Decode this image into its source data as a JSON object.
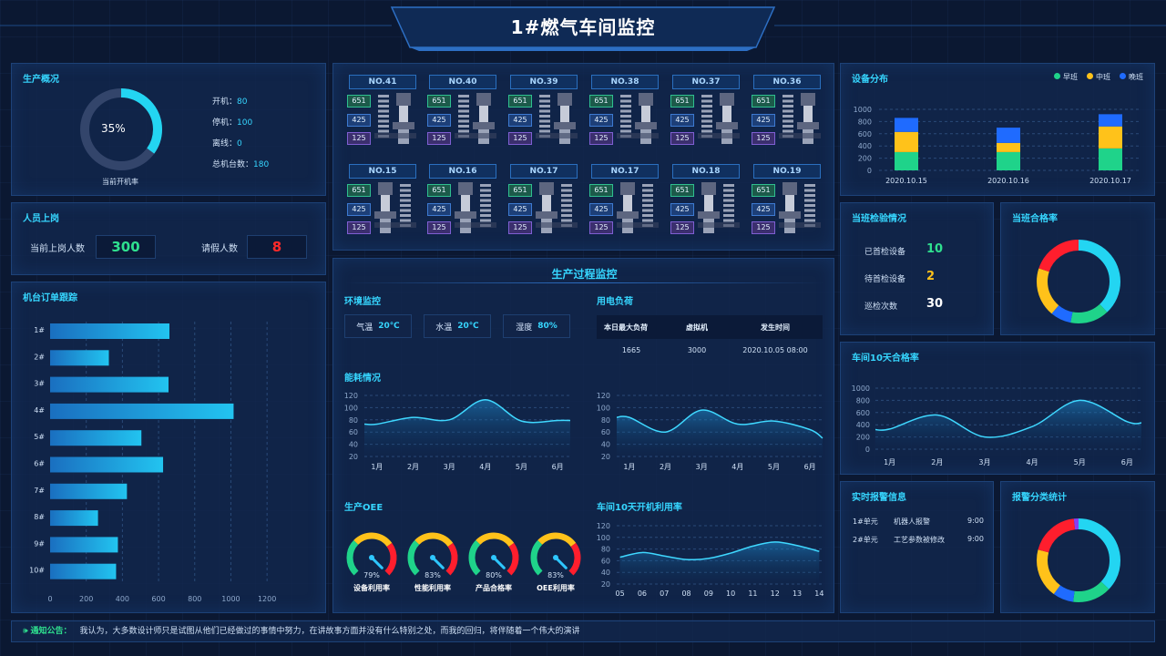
{
  "header": {
    "title": "1#燃气车间监控"
  },
  "production": {
    "title": "生产概况",
    "ring_value": "35%",
    "ring_fraction": 0.35,
    "ring_caption": "当前开机率",
    "stats": [
      {
        "label": "开机：",
        "value": "80"
      },
      {
        "label": "停机：",
        "value": "100"
      },
      {
        "label": "离线：",
        "value": "0"
      },
      {
        "label": "总机台数：",
        "value": "180"
      }
    ]
  },
  "staff": {
    "title": "人员上岗",
    "on_duty_label": "当前上岗人数",
    "on_duty_value": "300",
    "leave_label": "请假人数",
    "leave_value": "8"
  },
  "orders": {
    "title": "机台订单跟踪",
    "chart_data": {
      "type": "bar",
      "orientation": "horizontal",
      "categories": [
        "1#",
        "2#",
        "3#",
        "4#",
        "5#",
        "6#",
        "7#",
        "8#",
        "9#",
        "10#"
      ],
      "values": [
        660,
        325,
        655,
        1015,
        505,
        625,
        425,
        265,
        375,
        365
      ],
      "xlim": [
        0,
        1300
      ],
      "xticks": [
        "0",
        "200",
        "400",
        "600",
        "800",
        "1000",
        "1200"
      ],
      "xtick_values": [
        0,
        200,
        400,
        600,
        800,
        1000,
        1200
      ],
      "grid": true
    }
  },
  "machines": {
    "row1": [
      "NO.41",
      "NO.40",
      "NO.39",
      "NO.38",
      "NO.37",
      "NO.36"
    ],
    "row2": [
      "NO.15",
      "NO.16",
      "NO.17",
      "NO.17",
      "NO.18",
      "NO.19"
    ],
    "values": [
      "651",
      "425",
      "125"
    ]
  },
  "process": {
    "title": "生产过程监控",
    "env": {
      "title": "环境监控",
      "items": [
        {
          "label": "气温",
          "value": "20℃"
        },
        {
          "label": "水温",
          "value": "20℃"
        },
        {
          "label": "湿度",
          "value": "80%"
        }
      ]
    },
    "power": {
      "title": "用电负荷",
      "headers": [
        "本日最大负荷",
        "虚拟机",
        "发生时间"
      ],
      "row": [
        "1665",
        "3000",
        "2020.10.05  08:00"
      ]
    },
    "energy": {
      "title": "能耗情况",
      "chart_data": [
        {
          "type": "area",
          "categories": [
            "1月",
            "2月",
            "3月",
            "4月",
            "5月",
            "6月"
          ],
          "values": [
            73,
            84,
            80,
            113,
            78,
            79
          ],
          "ylim": [
            20,
            120
          ],
          "yticks": [
            "120",
            "100",
            "80",
            "60",
            "40",
            "20"
          ],
          "ytick_values": [
            120,
            100,
            80,
            60,
            40,
            20
          ]
        },
        {
          "type": "area",
          "categories": [
            "1月",
            "2月",
            "3月",
            "4月",
            "5月",
            "6月"
          ],
          "values": [
            84,
            60,
            96,
            73,
            78,
            64
          ],
          "ylim": [
            20,
            120
          ],
          "yticks": [
            "120",
            "100",
            "80",
            "60",
            "40",
            "20"
          ],
          "ytick_values": [
            120,
            100,
            80,
            60,
            40,
            20
          ]
        }
      ]
    },
    "oee": {
      "title": "生产OEE",
      "gauges": [
        {
          "value": "79%",
          "fraction": 0.79,
          "label": "设备利用率"
        },
        {
          "value": "83%",
          "fraction": 0.83,
          "label": "性能利用率"
        },
        {
          "value": "80%",
          "fraction": 0.8,
          "label": "产品合格率"
        },
        {
          "value": "83%",
          "fraction": 0.83,
          "label": "OEE利用率"
        }
      ]
    },
    "utilization": {
      "title": "车间10天开机利用率",
      "chart_data": {
        "type": "area",
        "categories": [
          "05",
          "06",
          "07",
          "08",
          "09",
          "10",
          "11",
          "12",
          "13",
          "14"
        ],
        "values": [
          66,
          74,
          68,
          62,
          64,
          73,
          85,
          92,
          86,
          76
        ],
        "ylim": [
          20,
          120
        ],
        "yticks": [
          "120",
          "100",
          "80",
          "60",
          "40",
          "20"
        ],
        "ytick_values": [
          120,
          100,
          80,
          60,
          40,
          20
        ]
      }
    }
  },
  "equipment": {
    "title": "设备分布",
    "legend": [
      "早班",
      "中班",
      "晚班"
    ],
    "colors": [
      "#1fd38a",
      "#ffc21a",
      "#1f6bff"
    ],
    "chart_data": {
      "type": "bar",
      "stacked": true,
      "categories": [
        "2020.10.15",
        "2020.10.16",
        "2020.10.17"
      ],
      "series": [
        {
          "name": "早班",
          "values": [
            300,
            300,
            360
          ]
        },
        {
          "name": "中班",
          "values": [
            330,
            150,
            360
          ]
        },
        {
          "name": "晚班",
          "values": [
            230,
            250,
            200
          ]
        }
      ],
      "ylim": [
        0,
        1000
      ],
      "yticks": [
        "1000",
        "800",
        "600",
        "400",
        "200",
        "0"
      ],
      "ytick_values": [
        1000,
        800,
        600,
        400,
        200,
        0
      ]
    }
  },
  "inspection": {
    "title": "当班检验情况",
    "items": [
      {
        "label": "已首检设备",
        "value": "10",
        "color": "#2fe08f"
      },
      {
        "label": "待首检设备",
        "value": "2",
        "color": "#ffc21a"
      },
      {
        "label": "巡检次数",
        "value": "30",
        "color": "#ffffff"
      }
    ]
  },
  "pass_rate": {
    "title": "当班合格率",
    "chart_data": {
      "type": "pie",
      "donut": true,
      "slices": [
        {
          "value": 0.38,
          "color": "#23d5f2"
        },
        {
          "value": 0.15,
          "color": "#1fd38a"
        },
        {
          "value": 0.08,
          "color": "#1f6bff"
        },
        {
          "value": 0.19,
          "color": "#ffc21a"
        },
        {
          "value": 0.2,
          "color": "#ff1e2d"
        }
      ]
    }
  },
  "pass10": {
    "title": "车间10天合格率",
    "chart_data": {
      "type": "area",
      "categories": [
        "1月",
        "2月",
        "3月",
        "4月",
        "5月",
        "6月"
      ],
      "values": [
        330,
        560,
        200,
        370,
        800,
        450
      ],
      "ylim": [
        0,
        1000
      ],
      "yticks": [
        "1000",
        "800",
        "600",
        "400",
        "200",
        "0"
      ],
      "ytick_values": [
        1000,
        800,
        600,
        400,
        200,
        0
      ]
    }
  },
  "alarms": {
    "title": "实时报警信息",
    "rows": [
      {
        "unit": "1#单元",
        "msg": "机器人报警",
        "time": "9:00"
      },
      {
        "unit": "2#单元",
        "msg": "工艺参数被修改",
        "time": "9:00"
      }
    ]
  },
  "alarm_stats": {
    "title": "报警分类统计",
    "chart_data": {
      "type": "pie",
      "donut": true,
      "slices": [
        {
          "value": 0.37,
          "color": "#23d5f2"
        },
        {
          "value": 0.15,
          "color": "#1fd38a"
        },
        {
          "value": 0.08,
          "color": "#1f6bff"
        },
        {
          "value": 0.19,
          "color": "#ffc21a"
        },
        {
          "value": 0.19,
          "color": "#ff1e2d"
        },
        {
          "value": 0.02,
          "color": "#8a3df2"
        }
      ]
    }
  },
  "notice": {
    "label": "通知公告：",
    "text": "我认为，大多数设计师只是试图从他们已经做过的事情中努力，在讲故事方面并没有什么特别之处，而我的回归，将伴随着一个伟大的演讲"
  }
}
